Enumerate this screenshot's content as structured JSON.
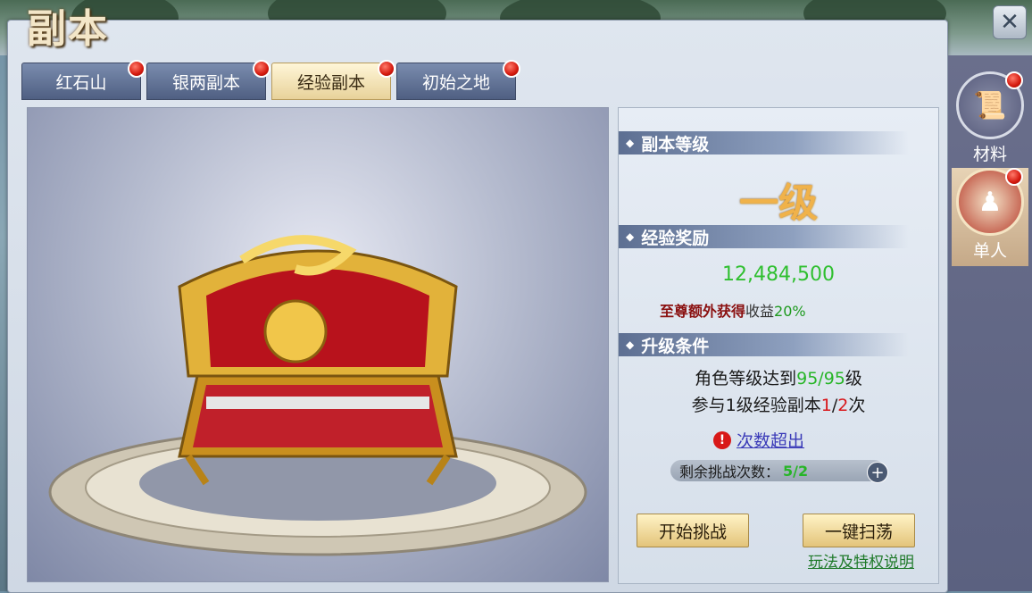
{
  "window": {
    "title": "副本",
    "close_icon": "close-icon"
  },
  "tabs": [
    {
      "label": "红石山",
      "active": false,
      "badge": true
    },
    {
      "label": "银两副本",
      "active": false,
      "badge": true
    },
    {
      "label": "经验副本",
      "active": true,
      "badge": true
    },
    {
      "label": "初始之地",
      "active": false,
      "badge": true
    }
  ],
  "panel": {
    "level_header": "副本等级",
    "level_value": "一级",
    "reward_header": "经验奖励",
    "exp_value": "12,484,500",
    "bonus_prefix": "至尊额外获得",
    "bonus_label": "收益",
    "bonus_value": "20%",
    "condition_header": "升级条件",
    "cond1_prefix": "角色等级达到",
    "cond1_current": "95",
    "cond1_sep": "/",
    "cond1_target": "95",
    "cond1_suffix": "级",
    "cond2_prefix": "参与1级经验副本",
    "cond2_current": "1",
    "cond2_sep": "/",
    "cond2_target": "2",
    "cond2_suffix": "次",
    "warning_text": "次数超出",
    "remain_label": "剩余挑战次数：",
    "remain_value": "5/2",
    "start_button": "开始挑战",
    "sweep_button": "一键扫荡",
    "help_link": "玩法及特权说明"
  },
  "side": [
    {
      "label": "材料",
      "icon": "scroll-icon",
      "badge": true
    },
    {
      "label": "单人",
      "icon": "person-icon",
      "badge": true,
      "active": true
    }
  ],
  "colors": {
    "accent_gold": "#f0b24a",
    "green": "#27b527",
    "red": "#d8161a"
  }
}
